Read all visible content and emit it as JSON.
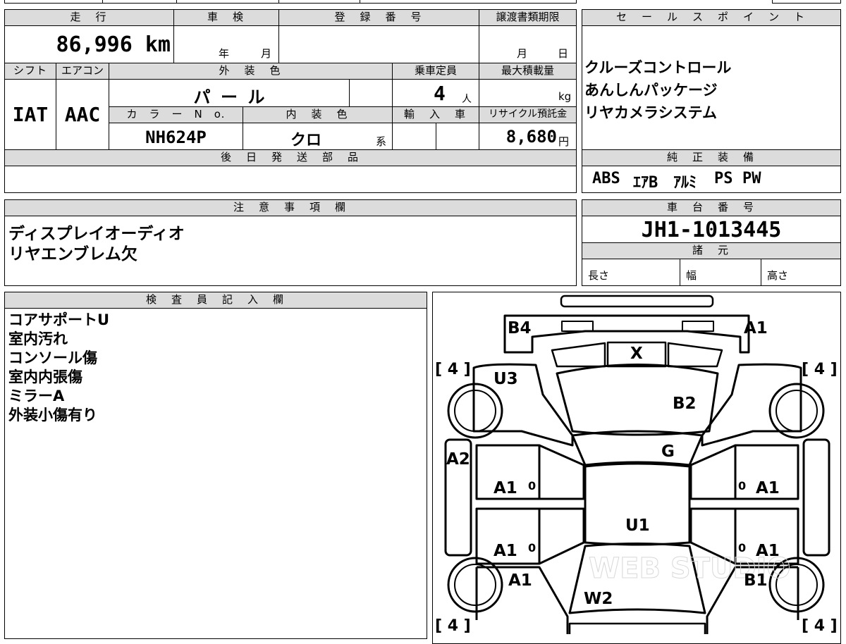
{
  "header": {
    "mileage_label": "走　行",
    "inspection_label": "車　検",
    "registration_label": "登　録　番　号",
    "transfer_label": "譲渡書類期限",
    "sales_point_label": "セ　ー　ル　ス　ポ　イ　ン　ト"
  },
  "vehicle": {
    "mileage": "86,996 km",
    "inspection_year_unit": "年",
    "inspection_month_unit": "月",
    "transfer_month_unit": "月",
    "transfer_day_unit": "日",
    "shift_label": "シフト",
    "shift": "IAT",
    "aircon_label": "エアコン",
    "aircon": "AAC",
    "exterior_color_label": "外　装　色",
    "exterior_color": "パ ー ル",
    "capacity_label": "乗車定員",
    "capacity": "4",
    "capacity_unit": "人",
    "max_load_label": "最大積載量",
    "max_load_unit": "kg",
    "color_no_label": "カ　ラ　ー　N　o.",
    "color_no": "NH624P",
    "interior_color_label": "内　装　色",
    "interior_color": "クロ",
    "interior_suffix": "系",
    "import_label": "輸　入　車",
    "recycle_label": "リサイクル預託金",
    "recycle_fee": "8,680",
    "recycle_unit": "円",
    "later_parts_label": "後　日　発　送　部　品"
  },
  "sales_points": [
    "クルーズコントロール",
    "あんしんパッケージ",
    "リヤカメラシステム"
  ],
  "equipment": {
    "label": "純　正　装　備",
    "items": [
      "ABS",
      "ｴｱB",
      "ｱﾙﾐ",
      "PS",
      "PW"
    ]
  },
  "notes": {
    "label": "注　意　事　項　欄",
    "lines": [
      "ディスプレイオーディオ",
      "リヤエンブレム欠"
    ]
  },
  "chassis": {
    "label": "車　台　番　号",
    "number": "JH1-1013445",
    "specs_label": "諸　元",
    "length_label": "長さ",
    "width_label": "幅",
    "height_label": "高さ"
  },
  "inspector": {
    "label": "検　査　員　記　入　欄",
    "lines": [
      "コアサポートU",
      "室内汚れ",
      "コンソール傷",
      "室内内張傷",
      "ミラーA",
      "外装小傷有り"
    ]
  },
  "diagram": {
    "tire_marks": [
      "[ 4 ]",
      "[ 4 ]",
      "[ 4 ]",
      "[ 4 ]"
    ],
    "codes": {
      "rear_left": "B4",
      "rear_right": "A1",
      "rear_center": "X",
      "left_upper": "U3",
      "hatch": "B2",
      "roof_front": "G",
      "left_side": "A2",
      "door_lf": "A1",
      "door_rf": "A1",
      "roof": "U1",
      "door_lr": "A1",
      "door_rr": "A1",
      "front_left": "A1",
      "front_right": "B1",
      "windshield": "W2",
      "small_marks": [
        "0",
        "0",
        "0",
        "0"
      ]
    },
    "watermark": "WEB STUDIO"
  }
}
